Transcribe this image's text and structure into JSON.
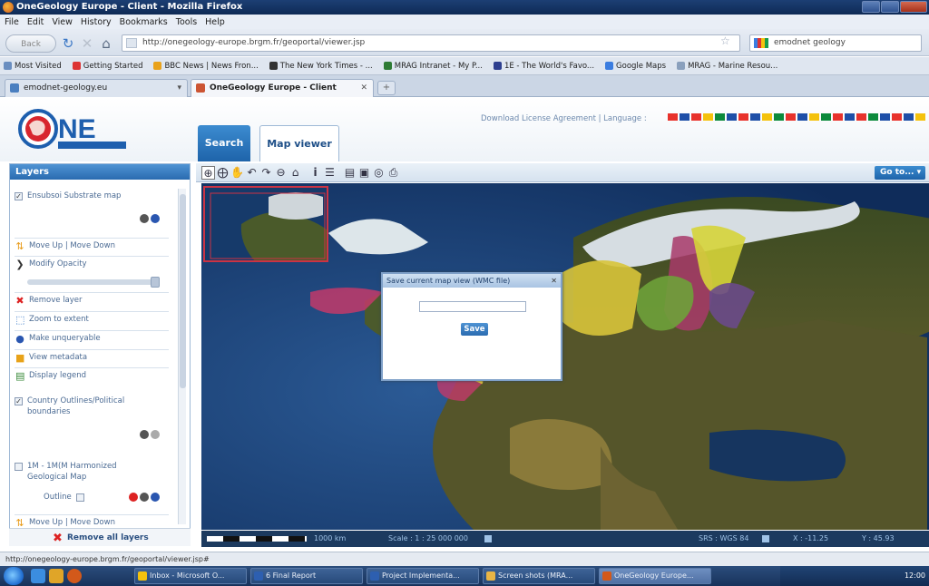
{
  "window": {
    "title": "OneGeology Europe - Client - Mozilla Firefox"
  },
  "menu": [
    "File",
    "Edit",
    "View",
    "History",
    "Bookmarks",
    "Tools",
    "Help"
  ],
  "nav": {
    "back_label": "Back",
    "url": "http://onegeology-europe.brgm.fr/geoportal/viewer.jsp",
    "search_value": "emodnet geology"
  },
  "bookmarks": [
    {
      "label": "Most Visited",
      "color": "#6a8ec0"
    },
    {
      "label": "Getting Started",
      "color": "#d33"
    },
    {
      "label": "BBC News | News Fron...",
      "color": "#e9a21b"
    },
    {
      "label": "The New York Times - ...",
      "color": "#333"
    },
    {
      "label": "MRAG Intranet - My P...",
      "color": "#2e7b34"
    },
    {
      "label": "1E - The World's Favo...",
      "color": "#2d3f8f"
    },
    {
      "label": "Google Maps",
      "color": "#3b7de0"
    },
    {
      "label": "MRAG - Marine Resou...",
      "color": "#8aa0bd"
    }
  ],
  "tabs": [
    {
      "label": "emodnet-geology.eu"
    },
    {
      "label": "OneGeology Europe - Client"
    }
  ],
  "app": {
    "logo_text": "NE",
    "logo_sub": "OneGeology Europe",
    "tab_search": "Search",
    "tab_mapviewer": "Map viewer",
    "license": "Download License Agreement  |  Language :",
    "flags": [
      "#e8322c",
      "#1e4fa8",
      "#e8322c",
      "#f4c20d",
      "#0c8a3c",
      "#1e4fa8",
      "#e8322c",
      "#1e4fa8",
      "#f4c20d",
      "#0c8a3c",
      "#e8322c",
      "#1e4fa8",
      "#f4c20d",
      "#0c8a3c",
      "#e8322c",
      "#1e4fa8",
      "#e8322c",
      "#0c8a3c",
      "#1e4fa8",
      "#e8322c",
      "#1e4fa8",
      "#f4c20d"
    ]
  },
  "layers": {
    "title": "Layers",
    "layer1": "Ensubsoi Substrate map",
    "move_label": "Move Up | Move Down",
    "modify_opacity": "Modify Opacity",
    "remove_layer": "Remove layer",
    "zoom_to_extent": "Zoom to extent",
    "make_unqueryable": "Make unqueryable",
    "view_metadata": "View metadata",
    "display_legend": "Display legend",
    "layer2_line1": "Country Outlines/Political",
    "layer2_line2": "boundaries",
    "layer3_line1": "1M - 1M(M Harmonized",
    "layer3_line2": "Geological Map",
    "outline_label": "Outline",
    "move_label2": "Move Up | Move Down",
    "remove_all": "Remove all layers"
  },
  "toolbar": {
    "goto_label": "Go to..."
  },
  "dialog": {
    "title": "Save current map view (WMC file)",
    "input_value": "",
    "save_label": "Save"
  },
  "mapstatus": {
    "scale_km": "1000 km",
    "scale": "Scale : 1 : 25 000 000",
    "srs": "SRS : WGS 84",
    "x": "X : -11.25",
    "y": "Y : 45.93"
  },
  "statusbar": {
    "text": "http://onegeology-europe.brgm.fr/geoportal/viewer.jsp#"
  },
  "taskbar": {
    "items": [
      {
        "label": "Inbox - Microsoft O...",
        "color": "#f4c20d"
      },
      {
        "label": "6 Final Report",
        "color": "#2d5fb0"
      },
      {
        "label": "Project Implementa...",
        "color": "#2d5fb0"
      },
      {
        "label": "Screen shots (MRA...",
        "color": "#e9b545"
      },
      {
        "label": "OneGeology Europe...",
        "color": "#d3591a"
      }
    ],
    "clock": "12:00"
  }
}
